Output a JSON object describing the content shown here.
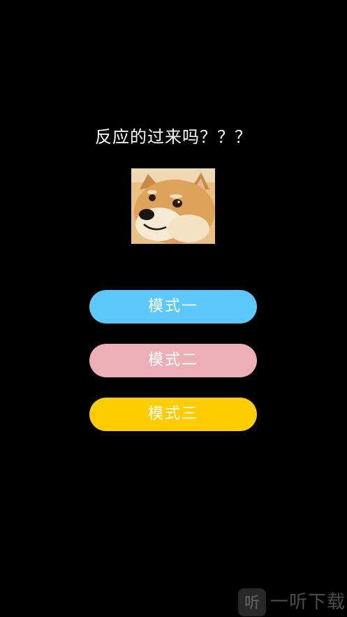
{
  "title": "反应的过来吗？？？",
  "avatar": {
    "icon": "doge-image"
  },
  "modes": [
    {
      "label": "模式一",
      "color": "#5bc8fb"
    },
    {
      "label": "模式二",
      "color": "#ecafb8"
    },
    {
      "label": "模式三",
      "color": "#ffcc00"
    }
  ],
  "watermark": {
    "text": "一听下载",
    "logo_glyph": "听"
  }
}
